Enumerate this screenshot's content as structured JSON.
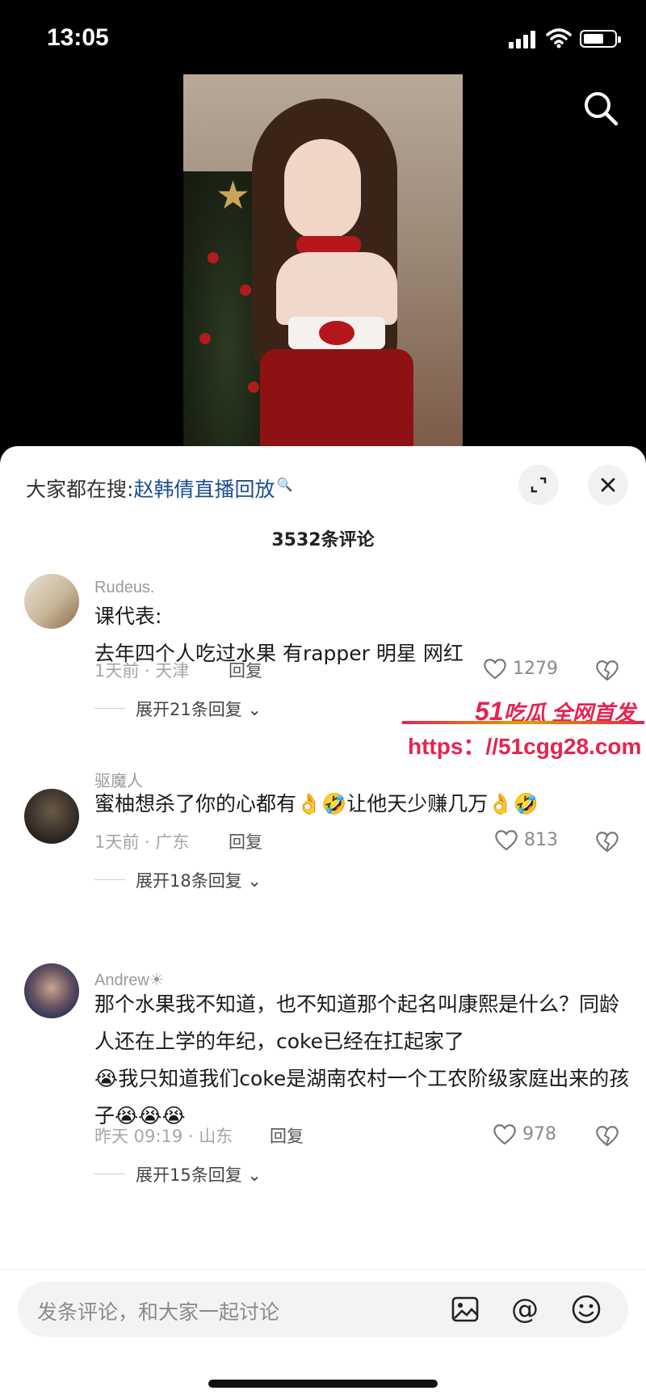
{
  "status_bar": {
    "time": "13:05"
  },
  "trending": {
    "prefix": "大家都在搜:",
    "term": "赵韩倩直播回放"
  },
  "comment_count": "3532条评论",
  "comments": [
    {
      "user": "Rudeus.",
      "lines": [
        "课代表:",
        "去年四个人吃过水果 有rapper 明星 网红"
      ],
      "time": "1天前 · 天津",
      "reply": "回复",
      "likes": "1279",
      "more": "展开21条回复"
    },
    {
      "user": "驱魔人",
      "text_a": "蜜柚想杀了你的心都有",
      "text_b": "让他天少赚几万",
      "time": "1天前 · 广东",
      "reply": "回复",
      "likes": "813",
      "more": "展开18条回复"
    },
    {
      "user": "Andrew☀",
      "text_a": "那个水果我不知道，也不知道那个起名叫康熙是什么？同龄人还在上学的年纪，coke已经在扛起家了",
      "text_b": "我只知道我们coke是湖南农村一个工农阶级家庭出来的孩子",
      "time": "昨天 09:19 · 山东",
      "reply": "回复",
      "likes": "978",
      "more": "展开15条回复"
    }
  ],
  "watermark": {
    "brand_num": "51",
    "brand_text": "吃瓜 全网首发",
    "url": "https：//51cgg28.com"
  },
  "input": {
    "placeholder": "发条评论，和大家一起讨论"
  },
  "icons": [
    "search-icon",
    "expand-icon",
    "close-icon",
    "heart-icon",
    "broken-heart-icon",
    "image-icon",
    "at-icon",
    "emoji-icon"
  ]
}
